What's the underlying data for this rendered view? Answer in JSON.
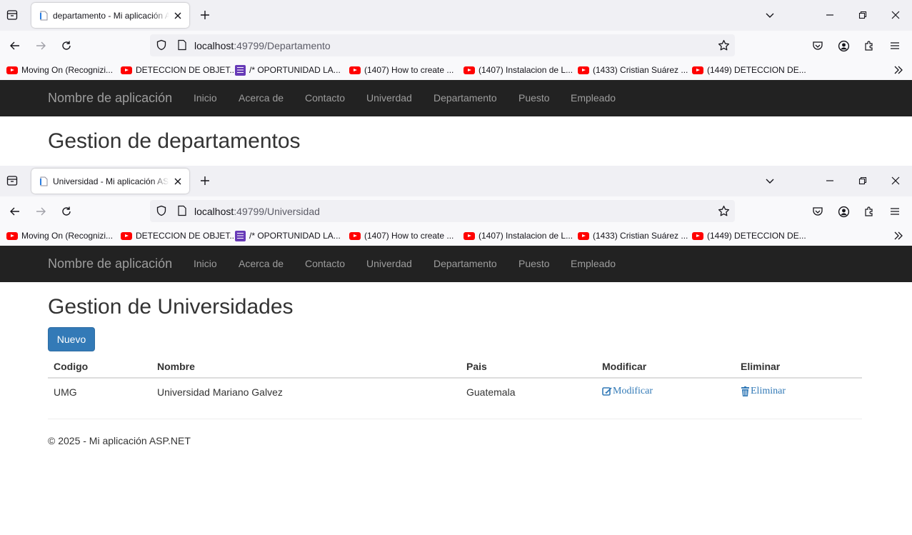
{
  "window_top": {
    "tab_title": "departamento - Mi aplicación ASP.NET",
    "url_host": "localhost",
    "url_rest": ":49799/Departamento",
    "site": {
      "brand": "Nombre de aplicación",
      "nav": [
        "Inicio",
        "Acerca de",
        "Contacto",
        "Univerdad",
        "Departamento",
        "Puesto",
        "Empleado"
      ],
      "heading": "Gestion de departamentos"
    }
  },
  "window_bottom": {
    "tab_title": "Universidad - Mi aplicación ASP.NET",
    "url_host": "localhost",
    "url_rest": ":49799/Universidad",
    "site": {
      "brand": "Nombre de aplicación",
      "nav": [
        "Inicio",
        "Acerca de",
        "Contacto",
        "Univerdad",
        "Departamento",
        "Puesto",
        "Empleado"
      ],
      "heading": "Gestion de Universidades",
      "new_button": "Nuevo",
      "table": {
        "headers": [
          "Codigo",
          "Nombre",
          "Pais",
          "Modificar",
          "Eliminar"
        ],
        "rows": [
          {
            "codigo": "UMG",
            "nombre": "Universidad Mariano Galvez",
            "pais": "Guatemala",
            "modificar": "Modificar",
            "eliminar": "Eliminar"
          }
        ]
      },
      "footer": "© 2025 - Mi aplicación ASP.NET"
    }
  },
  "bookmarks": [
    {
      "icon": "youtube-icon",
      "label": "Moving On (Recognizi..."
    },
    {
      "icon": "youtube-icon",
      "label": "DETECCION DE OBJET..."
    },
    {
      "icon": "forms-icon",
      "label": "/* OPORTUNIDAD LA..."
    },
    {
      "icon": "youtube-icon",
      "label": "(1407) How to create ..."
    },
    {
      "icon": "youtube-icon",
      "label": "(1407) Instalacion de L..."
    },
    {
      "icon": "youtube-icon",
      "label": "(1433) Cristian Suárez ..."
    },
    {
      "icon": "youtube-icon",
      "label": "(1449) DETECCION DE..."
    }
  ],
  "colors": {
    "site_navbar": "#222222",
    "nav_link": "#9d9d9d",
    "primary_button": "#337ab7",
    "link": "#337ab7"
  }
}
